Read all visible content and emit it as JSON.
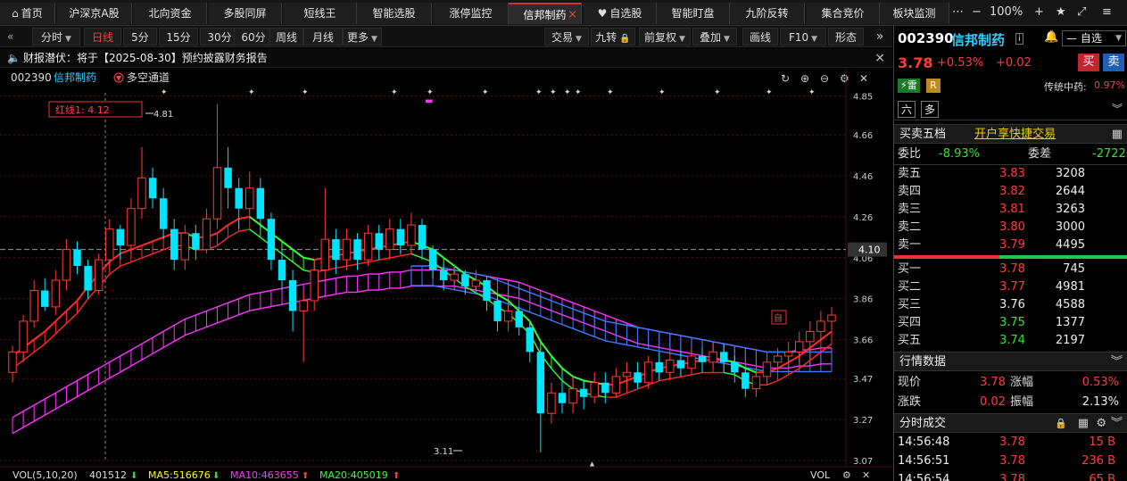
{
  "top_tabs": [
    {
      "label": "首页",
      "icon": "home-icon"
    },
    {
      "label": "沪深京A股"
    },
    {
      "label": "北向资金"
    },
    {
      "label": "多股同屏"
    },
    {
      "label": "短线王"
    },
    {
      "label": "智能选股"
    },
    {
      "label": "涨停监控"
    },
    {
      "label": "信邦制药",
      "active": true,
      "closable": true
    },
    {
      "label": "自选股",
      "icon": "heart-icon"
    },
    {
      "label": "智能盯盘"
    },
    {
      "label": "九阶反转"
    },
    {
      "label": "集合竞价"
    },
    {
      "label": "板块监测"
    }
  ],
  "window_controls": {
    "zoom": "100%",
    "more": "»"
  },
  "toolbar": {
    "left": [
      {
        "label": "分时",
        "dd": true
      },
      {
        "label": "日线",
        "active": true
      },
      {
        "label": "5分"
      },
      {
        "label": "15分"
      },
      {
        "label": "30分"
      },
      {
        "label": "60分"
      },
      {
        "label": "周线"
      },
      {
        "label": "月线"
      },
      {
        "label": "更多",
        "dd": true
      }
    ],
    "right": [
      {
        "label": "交易",
        "dd": true
      },
      {
        "label": "九转",
        "lock": true
      },
      {
        "label": "前复权",
        "dd": true
      },
      {
        "label": "叠加",
        "dd": true
      },
      {
        "label": "画线"
      },
      {
        "label": "F10",
        "dd": true
      },
      {
        "label": "形态"
      }
    ]
  },
  "banner": {
    "text": "财报潜伏：将于【2025-08-30】预约披露财务报告",
    "close": "×"
  },
  "chart_header": {
    "code": "002390",
    "name": "信邦制药",
    "indicator": "多空通道"
  },
  "chart_annotations": {
    "red_line_label": "红线1: 4.12",
    "high_label": "4.81",
    "low_label": "3.11",
    "current_price_tag": "4.10",
    "self_marker": "自"
  },
  "y_axis_ticks": [
    "4.85",
    "4.66",
    "4.46",
    "4.26",
    "4.06",
    "3.86",
    "3.66",
    "3.47",
    "3.27",
    "3.07"
  ],
  "volume_bar": {
    "label": "VOL(5,10,20)",
    "vol": "401512",
    "ma5": "MA5:516676",
    "ma10": "MA10:463655",
    "ma20": "MA20:405019",
    "right_label": "VOL"
  },
  "colors": {
    "up": "#ff3b3b",
    "down": "#00e5ff",
    "ma_green": "#33ff33",
    "ma_magenta": "#ff33ff",
    "ma_blue": "#3b7bff",
    "ma_red": "#ff2a2a"
  },
  "stock": {
    "code": "002390",
    "name": "信邦制药",
    "dropdown": "自选",
    "price": "3.78",
    "change_pct": "+0.53%",
    "change": "+0.02",
    "buy_btn": "买",
    "sell_btn": "卖",
    "tags": [
      "雷",
      "R"
    ],
    "sector": "传统中药:",
    "sector_pct": "0.97%",
    "tag2": [
      "六",
      "多"
    ]
  },
  "order_book": {
    "title": "买卖五档",
    "link": "开户享快捷交易",
    "ratio_label": "委比",
    "ratio_value": "-8.93%",
    "diff_label": "委差",
    "diff_value": "-2722",
    "asks": [
      {
        "label": "卖五",
        "price": "3.83",
        "vol": "3208"
      },
      {
        "label": "卖四",
        "price": "3.82",
        "vol": "2644"
      },
      {
        "label": "卖三",
        "price": "3.81",
        "vol": "3263"
      },
      {
        "label": "卖二",
        "price": "3.80",
        "vol": "3000"
      },
      {
        "label": "卖一",
        "price": "3.79",
        "vol": "4495"
      }
    ],
    "bids": [
      {
        "label": "买一",
        "price": "3.78",
        "vol": "745"
      },
      {
        "label": "买二",
        "price": "3.77",
        "vol": "4981"
      },
      {
        "label": "买三",
        "price": "3.76",
        "vol": "4588"
      },
      {
        "label": "买四",
        "price": "3.75",
        "vol": "1377"
      },
      {
        "label": "买五",
        "price": "3.74",
        "vol": "2197"
      }
    ]
  },
  "quote": {
    "title": "行情数据",
    "rows": [
      {
        "l1": "现价",
        "v1": "3.78",
        "l2": "涨幅",
        "v2": "0.53%"
      },
      {
        "l1": "涨跌",
        "v1": "0.02",
        "l2": "振幅",
        "v2": "2.13%"
      }
    ]
  },
  "ticks": {
    "title": "分时成交",
    "rows": [
      {
        "time": "14:56:48",
        "price": "3.78",
        "vol": "15 B"
      },
      {
        "time": "14:56:51",
        "price": "3.78",
        "vol": "236 B"
      },
      {
        "time": "14:56:54",
        "price": "3.78",
        "vol": "65 B"
      }
    ]
  },
  "chart_data": {
    "type": "candlestick",
    "price_range": [
      3.07,
      4.9
    ],
    "candles": [
      [
        3.5,
        3.6,
        3.45,
        3.63
      ],
      [
        3.6,
        3.75,
        3.55,
        3.78
      ],
      [
        3.75,
        3.9,
        3.72,
        3.95
      ],
      [
        3.9,
        3.82,
        3.8,
        3.96
      ],
      [
        3.82,
        3.95,
        3.78,
        4.0
      ],
      [
        3.95,
        4.1,
        3.9,
        4.15
      ],
      [
        4.1,
        4.02,
        3.98,
        4.14
      ],
      [
        4.02,
        3.9,
        3.86,
        4.05
      ],
      [
        3.9,
        4.05,
        3.88,
        4.08
      ],
      [
        4.05,
        4.2,
        4.0,
        4.25
      ],
      [
        4.2,
        4.12,
        4.05,
        4.22
      ],
      [
        4.12,
        4.3,
        4.08,
        4.35
      ],
      [
        4.3,
        4.45,
        4.25,
        4.6
      ],
      [
        4.45,
        4.35,
        4.3,
        4.5
      ],
      [
        4.35,
        4.2,
        4.15,
        4.4
      ],
      [
        4.2,
        4.05,
        4.0,
        4.25
      ],
      [
        4.05,
        4.18,
        4.0,
        4.22
      ],
      [
        4.18,
        4.1,
        4.05,
        4.22
      ],
      [
        4.1,
        4.25,
        4.08,
        4.3
      ],
      [
        4.25,
        4.5,
        4.2,
        4.81
      ],
      [
        4.5,
        4.4,
        4.3,
        4.6
      ],
      [
        4.4,
        4.3,
        4.2,
        4.45
      ],
      [
        4.3,
        4.4,
        4.25,
        4.48
      ],
      [
        4.4,
        4.25,
        4.2,
        4.45
      ],
      [
        4.25,
        4.05,
        4.0,
        4.28
      ],
      [
        4.05,
        3.95,
        3.9,
        4.1
      ],
      [
        3.95,
        3.8,
        3.7,
        4.0
      ],
      [
        3.8,
        3.85,
        3.55,
        3.9
      ],
      [
        3.85,
        4.0,
        3.8,
        4.05
      ],
      [
        4.0,
        4.15,
        3.95,
        4.4
      ],
      [
        4.15,
        4.05,
        3.98,
        4.2
      ],
      [
        4.05,
        4.15,
        4.0,
        4.2
      ],
      [
        4.15,
        4.05,
        4.0,
        4.18
      ],
      [
        4.05,
        4.18,
        4.02,
        4.22
      ],
      [
        4.18,
        4.1,
        4.05,
        4.22
      ],
      [
        4.1,
        4.2,
        4.05,
        4.25
      ],
      [
        4.2,
        4.12,
        4.08,
        4.25
      ],
      [
        4.12,
        4.22,
        4.08,
        4.28
      ],
      [
        4.22,
        4.1,
        4.05,
        4.25
      ],
      [
        4.1,
        4.0,
        3.96,
        4.12
      ],
      [
        4.0,
        3.95,
        3.9,
        4.03
      ],
      [
        3.95,
        3.98,
        3.9,
        4.02
      ],
      [
        3.98,
        3.92,
        3.88,
        4.0
      ],
      [
        3.92,
        3.95,
        3.88,
        4.0
      ],
      [
        3.95,
        3.85,
        3.8,
        3.97
      ],
      [
        3.85,
        3.75,
        3.7,
        3.88
      ],
      [
        3.75,
        3.8,
        3.7,
        3.85
      ],
      [
        3.8,
        3.72,
        3.68,
        3.82
      ],
      [
        3.72,
        3.6,
        3.55,
        3.75
      ],
      [
        3.6,
        3.3,
        3.11,
        3.62
      ],
      [
        3.3,
        3.4,
        3.25,
        3.45
      ],
      [
        3.4,
        3.35,
        3.3,
        3.5
      ],
      [
        3.35,
        3.42,
        3.3,
        3.48
      ],
      [
        3.42,
        3.38,
        3.32,
        3.46
      ],
      [
        3.38,
        3.45,
        3.35,
        3.5
      ],
      [
        3.45,
        3.4,
        3.35,
        3.5
      ],
      [
        3.4,
        3.48,
        3.38,
        3.52
      ],
      [
        3.48,
        3.5,
        3.42,
        3.55
      ],
      [
        3.5,
        3.45,
        3.42,
        3.55
      ],
      [
        3.45,
        3.55,
        3.42,
        3.58
      ],
      [
        3.55,
        3.5,
        3.46,
        3.6
      ],
      [
        3.5,
        3.56,
        3.46,
        3.6
      ],
      [
        3.56,
        3.52,
        3.48,
        3.6
      ],
      [
        3.52,
        3.58,
        3.5,
        3.62
      ],
      [
        3.58,
        3.55,
        3.5,
        3.62
      ],
      [
        3.55,
        3.6,
        3.52,
        3.65
      ],
      [
        3.6,
        3.55,
        3.5,
        3.64
      ],
      [
        3.55,
        3.5,
        3.45,
        3.58
      ],
      [
        3.5,
        3.42,
        3.38,
        3.52
      ],
      [
        3.42,
        3.48,
        3.38,
        3.52
      ],
      [
        3.48,
        3.55,
        3.45,
        3.6
      ],
      [
        3.55,
        3.58,
        3.5,
        3.62
      ],
      [
        3.58,
        3.6,
        3.55,
        3.65
      ],
      [
        3.6,
        3.65,
        3.55,
        3.7
      ],
      [
        3.65,
        3.7,
        3.6,
        3.75
      ],
      [
        3.7,
        3.75,
        3.65,
        3.8
      ],
      [
        3.75,
        3.78,
        3.7,
        3.82
      ]
    ],
    "ma_red": [
      3.58,
      3.62,
      3.66,
      3.7,
      3.75,
      3.8,
      3.85,
      3.92,
      3.98,
      4.04,
      4.08,
      4.1,
      4.12,
      4.14,
      4.16,
      4.18,
      4.18,
      4.16,
      4.16,
      4.18,
      4.22,
      4.25,
      4.26,
      4.22,
      4.18,
      4.14,
      4.1,
      4.06,
      4.05,
      4.06,
      4.07,
      4.08,
      4.09,
      4.1,
      4.11,
      4.12,
      4.13,
      4.14,
      4.12,
      4.1,
      4.06,
      4.02,
      3.98,
      3.95,
      3.92,
      3.88,
      3.85,
      3.8,
      3.75,
      3.65,
      3.58,
      3.52,
      3.48,
      3.46,
      3.45,
      3.44,
      3.44,
      3.46,
      3.48,
      3.5,
      3.52,
      3.53,
      3.54,
      3.55,
      3.56,
      3.56,
      3.56,
      3.55,
      3.52,
      3.5,
      3.5,
      3.52,
      3.55,
      3.58,
      3.62,
      3.66,
      3.7
    ],
    "ma_magenta": [
      3.28,
      3.31,
      3.34,
      3.37,
      3.4,
      3.43,
      3.46,
      3.49,
      3.52,
      3.55,
      3.58,
      3.61,
      3.64,
      3.67,
      3.7,
      3.73,
      3.76,
      3.78,
      3.8,
      3.82,
      3.84,
      3.86,
      3.88,
      3.89,
      3.9,
      3.91,
      3.92,
      3.93,
      3.94,
      3.95,
      3.96,
      3.97,
      3.97,
      3.98,
      3.98,
      3.99,
      3.99,
      4.0,
      4.0,
      4.0,
      4.0,
      4.0,
      3.99,
      3.98,
      3.97,
      3.96,
      3.95,
      3.94,
      3.92,
      3.9,
      3.88,
      3.86,
      3.84,
      3.82,
      3.8,
      3.78,
      3.76,
      3.74,
      3.72,
      3.71,
      3.7,
      3.69,
      3.68,
      3.67,
      3.66,
      3.65,
      3.64,
      3.63,
      3.62,
      3.61,
      3.6,
      3.6,
      3.6,
      3.61,
      3.61,
      3.62,
      3.62
    ],
    "ma_blue": [
      null,
      null,
      null,
      null,
      null,
      null,
      null,
      null,
      null,
      null,
      null,
      null,
      null,
      null,
      null,
      null,
      null,
      null,
      null,
      null,
      null,
      null,
      null,
      null,
      null,
      null,
      null,
      null,
      null,
      null,
      null,
      null,
      null,
      null,
      null,
      null,
      null,
      4.02,
      4.02,
      4.02,
      4.01,
      4.0,
      3.99,
      3.98,
      3.97,
      3.95,
      3.93,
      3.91,
      3.89,
      3.87,
      3.85,
      3.83,
      3.81,
      3.79,
      3.77,
      3.75,
      3.74,
      3.73,
      3.72,
      3.71,
      3.7,
      3.69,
      3.68,
      3.67,
      3.66,
      3.65,
      3.64,
      3.63,
      3.62,
      3.61,
      3.6,
      3.6,
      3.6,
      3.6,
      3.6,
      3.6,
      3.6
    ]
  }
}
